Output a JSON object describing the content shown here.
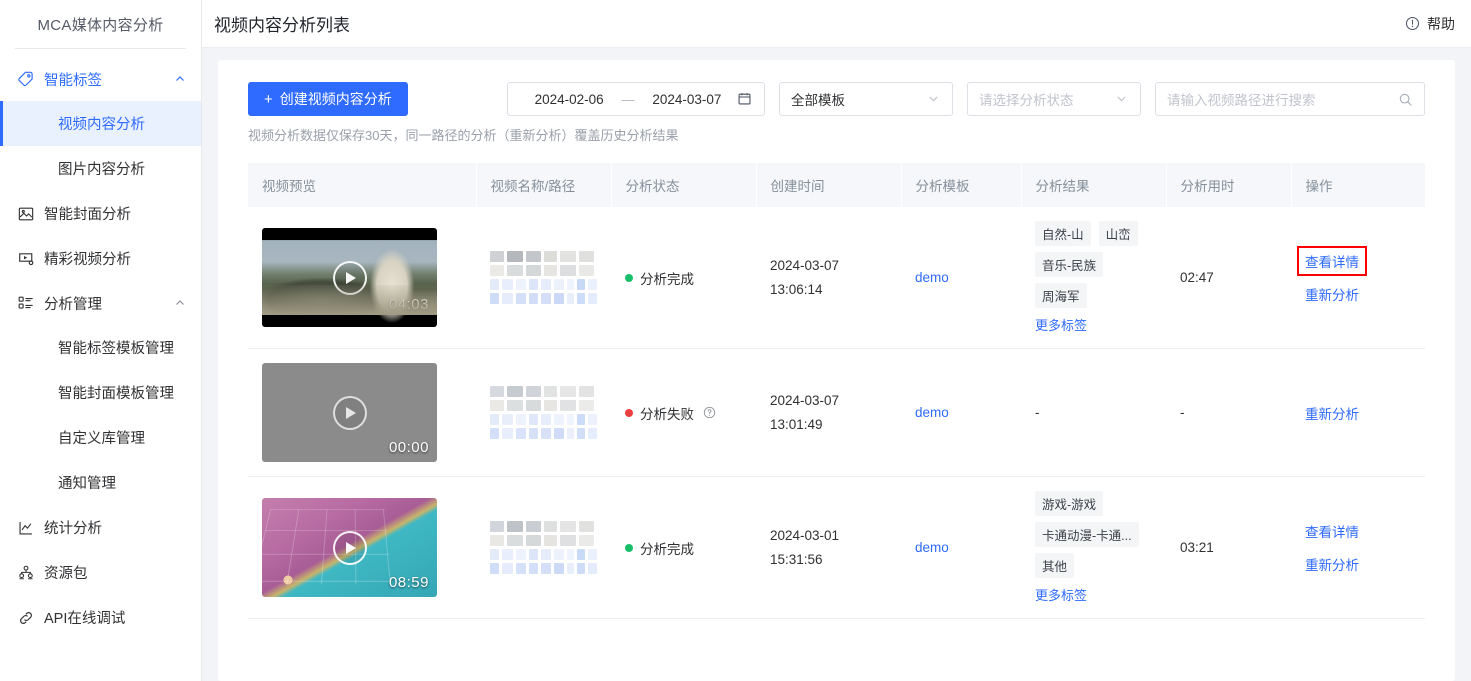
{
  "sidebar": {
    "brand": "MCA媒体内容分析",
    "groups": [
      {
        "label": "智能标签",
        "icon": "tag-icon",
        "active": true,
        "expanded": true,
        "children": [
          {
            "label": "视频内容分析",
            "selected": true
          },
          {
            "label": "图片内容分析",
            "selected": false
          }
        ]
      }
    ],
    "items_mid": [
      {
        "label": "智能封面分析",
        "icon": "image-icon"
      },
      {
        "label": "精彩视频分析",
        "icon": "video-settings-icon"
      }
    ],
    "group2": {
      "label": "分析管理",
      "icon": "list-icon",
      "expanded": true,
      "children": [
        {
          "label": "智能标签模板管理"
        },
        {
          "label": "智能封面模板管理"
        },
        {
          "label": "自定义库管理"
        },
        {
          "label": "通知管理"
        }
      ]
    },
    "items_bottom": [
      {
        "label": "统计分析",
        "icon": "chart-icon"
      },
      {
        "label": "资源包",
        "icon": "resource-icon"
      },
      {
        "label": "API在线调试",
        "icon": "link-icon"
      }
    ]
  },
  "header": {
    "title": "视频内容分析列表",
    "help_label": "帮助",
    "help_icon": "info-circle-icon"
  },
  "toolbar": {
    "create_button": "创建视频内容分析",
    "create_plus": "+",
    "date_start": "2024-02-06",
    "date_sep": "—",
    "date_end": "2024-03-07",
    "calendar_icon": "calendar-icon",
    "template_select_value": "全部模板",
    "status_select_placeholder": "请选择分析状态",
    "search_placeholder": "请输入视频路径进行搜索",
    "search_icon": "search-icon",
    "hint": "视频分析数据仅保存30天，同一路径的分析（重新分析）覆盖历史分析结果"
  },
  "table": {
    "columns": [
      "视频预览",
      "视频名称/路径",
      "分析状态",
      "创建时间",
      "分析模板",
      "分析结果",
      "分析用时",
      "操作"
    ],
    "rows": [
      {
        "thumb_style": "t1",
        "duration": "04:03",
        "name_masked": true,
        "status": {
          "text": "分析完成",
          "color": "#19be6b",
          "has_help": false
        },
        "created_date": "2024-03-07",
        "created_time": "13:06:14",
        "template": "demo",
        "tags": [
          "自然-山",
          "山峦",
          "音乐-民族",
          "周海军"
        ],
        "more_tags_label": "更多标签",
        "elapsed": "02:47",
        "ops": [
          "查看详情",
          "重新分析"
        ],
        "highlighted_op": "查看详情"
      },
      {
        "thumb_style": "t2",
        "duration": "00:00",
        "name_masked": true,
        "status": {
          "text": "分析失败",
          "color": "#ed3f3f",
          "has_help": true
        },
        "created_date": "2024-03-07",
        "created_time": "13:01:49",
        "template": "demo",
        "tags": [],
        "more_tags_label": "",
        "result_empty": "-",
        "elapsed": "-",
        "ops": [
          "重新分析"
        ],
        "highlighted_op": ""
      },
      {
        "thumb_style": "t3",
        "duration": "08:59",
        "name_masked": true,
        "status": {
          "text": "分析完成",
          "color": "#19be6b",
          "has_help": false
        },
        "created_date": "2024-03-01",
        "created_time": "15:31:56",
        "template": "demo",
        "tags": [
          "游戏-游戏",
          "卡通动漫-卡通...",
          "其他"
        ],
        "more_tags_label": "更多标签",
        "elapsed": "03:21",
        "ops": [
          "查看详情",
          "重新分析"
        ],
        "highlighted_op": ""
      }
    ]
  },
  "colors": {
    "primary": "#2f6bff",
    "success": "#19be6b",
    "danger": "#ed3f3f",
    "highlight_box": "#ff0000",
    "page_bg": "#f3f4f7",
    "header_bg": "#f5f7fa"
  }
}
